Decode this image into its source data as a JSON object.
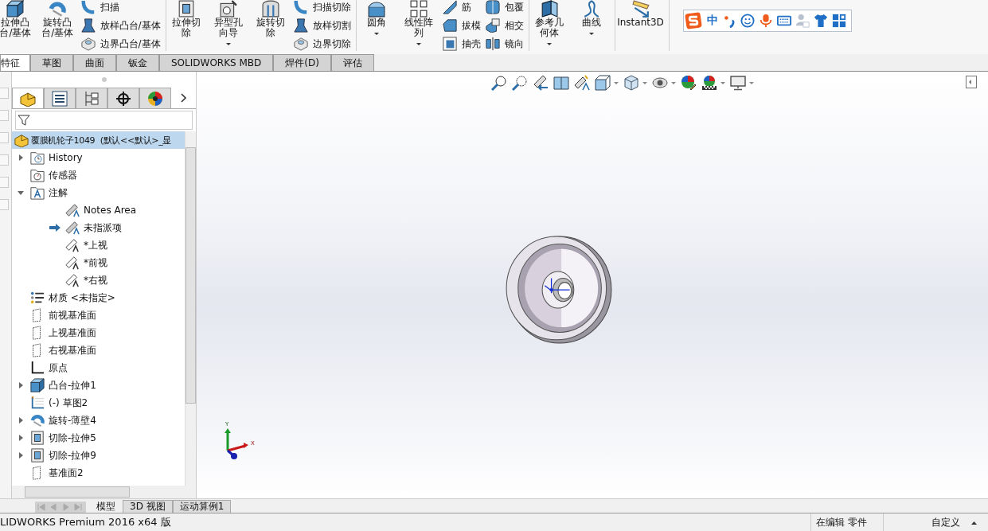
{
  "ribbon": {
    "groups": [
      {
        "big": [
          {
            "label": "拉伸凸台/基体",
            "caret": false
          },
          {
            "label": "旋转凸台/基体",
            "caret": false
          }
        ],
        "small": [
          [
            {
              "label": "扫描"
            },
            {
              "label": "放样凸台/基体"
            },
            {
              "label": "边界凸台/基体"
            }
          ]
        ]
      },
      {
        "big": [
          {
            "label": "拉伸切除",
            "caret": false
          },
          {
            "label": "异型孔向导",
            "caret": true
          },
          {
            "label": "旋转切除",
            "caret": false
          }
        ],
        "small": [
          [
            {
              "label": "扫描切除"
            },
            {
              "label": "放样切割"
            },
            {
              "label": "边界切除"
            }
          ]
        ]
      },
      {
        "big": [
          {
            "label": "圆角",
            "caret": true
          },
          {
            "label": "线性阵列",
            "caret": true
          }
        ],
        "small": [
          [
            {
              "label": "筋"
            },
            {
              "label": "拔模"
            },
            {
              "label": "抽壳"
            }
          ],
          [
            {
              "label": "包覆"
            },
            {
              "label": "相交"
            },
            {
              "label": "镜向"
            }
          ]
        ]
      },
      {
        "big": [
          {
            "label": "参考几何体",
            "caret": true
          },
          {
            "label": "曲线",
            "caret": true
          }
        ]
      },
      {
        "big": [
          {
            "label": "Instant3D",
            "caret": false
          }
        ]
      }
    ]
  },
  "command_tabs": [
    {
      "label": "特征",
      "selected": true
    },
    {
      "label": "草图",
      "selected": false
    },
    {
      "label": "曲面",
      "selected": false
    },
    {
      "label": "钣金",
      "selected": false
    },
    {
      "label": "SOLIDWORKS MBD",
      "selected": false
    },
    {
      "label": "焊件(D)",
      "selected": false
    },
    {
      "label": "评估",
      "selected": false
    }
  ],
  "ime_toolbar": {
    "mode": "中"
  },
  "view_toolbar": [
    {
      "caret": false
    },
    {
      "caret": false
    },
    {
      "caret": false
    },
    {
      "caret": false
    },
    {
      "caret": false
    },
    {
      "caret": true
    },
    {
      "caret": true
    },
    {
      "caret": true
    },
    {
      "caret": false
    },
    {
      "caret": true
    },
    {
      "caret": true
    }
  ],
  "panel_tabs": [
    {
      "selected": true
    },
    {
      "selected": false
    },
    {
      "selected": false
    },
    {
      "selected": false
    },
    {
      "selected": false
    }
  ],
  "tree": {
    "root": {
      "label": "覆膜机轮子1049  (默认<<默认>_显",
      "selected": true
    },
    "items": [
      {
        "label": "History",
        "expanded": false,
        "selected": false
      },
      {
        "label": "传感器",
        "selected": false
      },
      {
        "label": "注解",
        "expanded": true,
        "selected": false,
        "children": [
          {
            "label": "Notes Area",
            "arrow": false,
            "selected": false
          },
          {
            "label": "未指派项",
            "arrow": true,
            "selected": false
          },
          {
            "label": "*上视",
            "arrow": false,
            "selected": false
          },
          {
            "label": "*前视",
            "arrow": false,
            "selected": false
          },
          {
            "label": "*右视",
            "arrow": false,
            "selected": false
          }
        ]
      },
      {
        "label": "材质 <未指定>",
        "selected": false
      },
      {
        "label": "前视基准面",
        "selected": false
      },
      {
        "label": "上视基准面",
        "selected": false
      },
      {
        "label": "右视基准面",
        "selected": false
      },
      {
        "label": "原点",
        "selected": false
      },
      {
        "label": "凸台-拉伸1",
        "expanded": false,
        "selected": false
      },
      {
        "label": "(-) 草图2",
        "selected": false
      },
      {
        "label": "旋转-薄壁4",
        "expanded": false,
        "selected": false
      },
      {
        "label": "切除-拉伸5",
        "expanded": false,
        "selected": false
      },
      {
        "label": "切除-拉伸9",
        "expanded": false,
        "selected": false
      },
      {
        "label": "基准面2",
        "selected": false
      }
    ]
  },
  "viewport": {
    "triad_labels": [
      "Y",
      "X"
    ]
  },
  "bottom_tabs": [
    {
      "label": "模型",
      "selected": true
    },
    {
      "label": "3D 视图",
      "selected": false
    },
    {
      "label": "运动算例1",
      "selected": false
    }
  ],
  "status_bar": {
    "product": "LIDWORKS Premium 2016 x64 版",
    "mode": "在编辑 零件",
    "units": "自定义"
  }
}
